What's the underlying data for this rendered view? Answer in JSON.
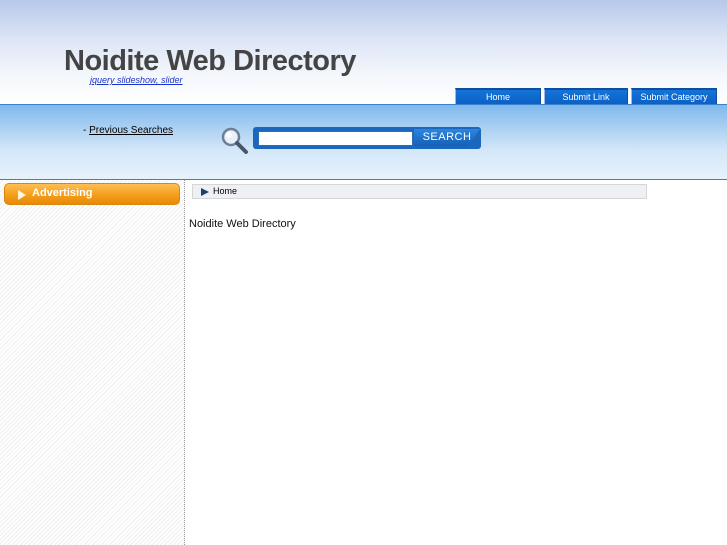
{
  "header": {
    "site_title": "Noidite Web Directory",
    "tagline": "jquery slideshow, slider"
  },
  "nav": {
    "items": [
      {
        "label": "Home"
      },
      {
        "label": "Submit Link"
      },
      {
        "label": "Submit Category"
      }
    ]
  },
  "search": {
    "prev_prefix": "- ",
    "prev_label": "Previous Searches",
    "input_value": "",
    "button_label": "SEARCH"
  },
  "sidebar": {
    "advertising_label": "Advertising"
  },
  "breadcrumb": {
    "home_label": "Home"
  },
  "main": {
    "title": "Noidite Web Directory"
  },
  "colors": {
    "nav_tab": "#0a5fc2",
    "search_band": "#a6cdf2",
    "advert_orange": "#f7a020",
    "title_gray": "#444444"
  },
  "icons": {
    "search": "magnifier-icon",
    "advert": "triangle-right-icon",
    "breadcrumb": "triangle-right-icon"
  }
}
